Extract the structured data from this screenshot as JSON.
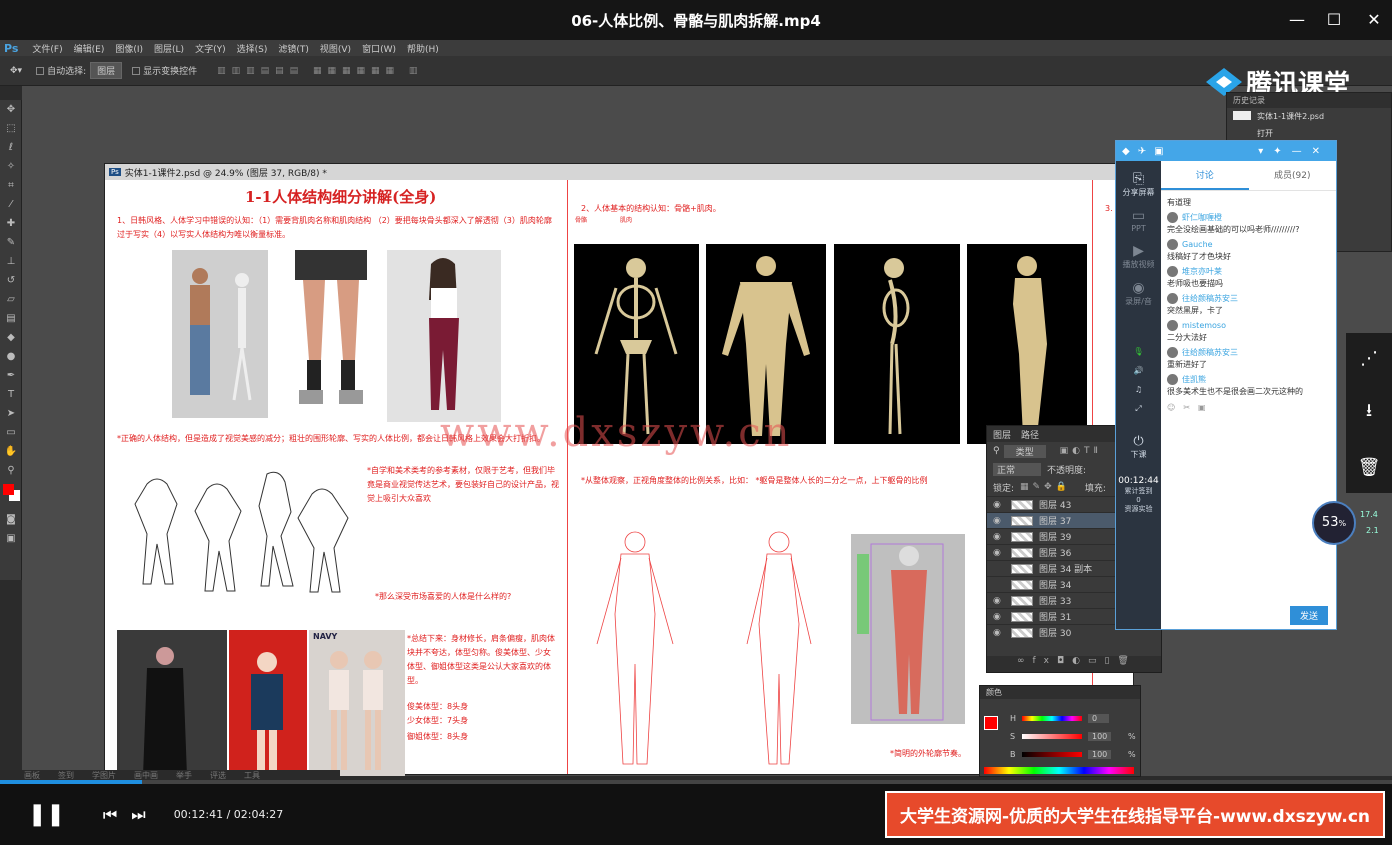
{
  "player": {
    "title": "06-人体比例、骨骼与肌肉拆解.mp4",
    "time_current": "00:12:41",
    "time_separator": " / ",
    "time_total": "02:04:27",
    "progress": 0.102,
    "banner": "大学生资源网-优质的大学生在线指导平台-www.dxszyw.cn",
    "speed_label": "53",
    "speed_unit": "%",
    "net_up": "17.4",
    "net_down": "2.1",
    "side_icons": [
      "share-icon",
      "download-icon",
      "delete-icon"
    ]
  },
  "ps": {
    "menu": [
      "文件(F)",
      "编辑(E)",
      "图像(I)",
      "图层(L)",
      "文字(Y)",
      "选择(S)",
      "滤镜(T)",
      "视图(V)",
      "窗口(W)",
      "帮助(H)"
    ],
    "logo": "Ps",
    "options": {
      "auto_select": "自动选择:",
      "auto_select_value": "图层",
      "show_transform": "显示变换控件"
    },
    "doc_tab": "实体1-1课件2.psd @ 24.9% (图层 37, RGB/8) *",
    "doc_mini": "Ps"
  },
  "canvas": {
    "title": "1-1人体结构细分讲解(全身)",
    "note1": "1、日韩风格、人体学习中错误的认知：（1）需要背肌肉名称和肌肉结构 （2）要把每块骨头都深入了解透彻（3）肌肉轮廓过于写实（4）以写实人体结构为唯以衡量标准。",
    "note2": "*正确的人体结构，但是造成了视觉美感的减分；粗壮的围形轮廓、写实的人体比例，都会让日韩风格上效果会大打折扣。",
    "note3": "*自学和美术类考的参考素材，仅限于艺考，但我们毕竟是商业视觉传达艺术，要包装好自己的设计产品，视觉上吸引大众喜欢",
    "note4": "*那么深受市场喜爱的人体是什么样的?",
    "note5": "*总结下来：身材修长，肩条偏瘦，肌肉体块并不夸达，体型匀称。俊美体型、少女体型、御姐体型这类是公认大家喜欢的体型。",
    "ratio1": "俊美体型：8头身",
    "ratio2": "少女体型：7头身",
    "ratio3": "御姐体型：8头身",
    "sec2_title": "2、人体基本的结构认知：骨骼+肌肉。",
    "sec2_note": "*从整体观察，正视角度整体的比例关系，比如：  *躯骨是整体人长的二分之一点，上下躯骨的比例",
    "sec2_small1": "骨骼",
    "sec2_small2": "肌肉",
    "sec3_mark": "3.",
    "muscle_caption": "*简明的外轮廓节奏。",
    "navy_label": "NAVY"
  },
  "watermark": "www.dxszyw.cn",
  "tencent": {
    "logo": "腾讯课堂"
  },
  "history": {
    "title": "历史记录",
    "item1": "实体1-1课件2.psd",
    "item2": "打开"
  },
  "layers": {
    "tab1": "图层",
    "tab2": "路径",
    "kind": "类型",
    "blend": "正常",
    "opacity": "不透明度:",
    "lock": "锁定:",
    "fill": "填充:",
    "rows": [
      {
        "name": "图层 43",
        "sel": false
      },
      {
        "name": "图层 37",
        "sel": true
      },
      {
        "name": "图层 39",
        "sel": false
      },
      {
        "name": "图层 36",
        "sel": false
      },
      {
        "name": "图层 34 副本",
        "sel": false
      },
      {
        "name": "图层 34",
        "sel": false
      },
      {
        "name": "图层 33",
        "sel": false
      },
      {
        "name": "图层 31",
        "sel": false
      },
      {
        "name": "图层 30",
        "sel": false
      }
    ]
  },
  "colorpanel": {
    "title": "颜色",
    "h": "H",
    "s": "S",
    "b": "B",
    "h_val": "0",
    "s_val": "100",
    "b_val": "100",
    "pct": "%"
  },
  "chat": {
    "tab_discuss": "讨论",
    "tab_members": "成员(92)",
    "intro": "有道理",
    "side_share": "分享屏幕",
    "side_ppt": "PPT",
    "side_video": "播放视频",
    "side_record": "录屏/音",
    "side_down": "下课",
    "side_time": "00:12:44",
    "side_sub1": "累计签到",
    "side_sub2": "0",
    "side_sub3": "资源实验",
    "send": "发送",
    "messages": [
      {
        "name": "虾仁咖喱橙",
        "text": "完全没绘画基础的可以吗老师/////////?"
      },
      {
        "name": "Gauche",
        "text": "线稿好了才色块好"
      },
      {
        "name": "堆京亦叶莱",
        "text": "老师吸也要描吗"
      },
      {
        "name": "往给颜稿苏安三",
        "text": "突然黑屏，卡了"
      },
      {
        "name": "mistemoso",
        "text": "二分大法好"
      },
      {
        "name": "往给颜稿苏安三",
        "text": "重新进好了"
      },
      {
        "name": "佳凯熊",
        "text": "很多美术生也不是很会画二次元这种的"
      }
    ]
  },
  "ps_bottom": [
    "画板",
    "签到",
    "学图片",
    "画中画",
    "举手",
    "评选",
    "工具"
  ]
}
